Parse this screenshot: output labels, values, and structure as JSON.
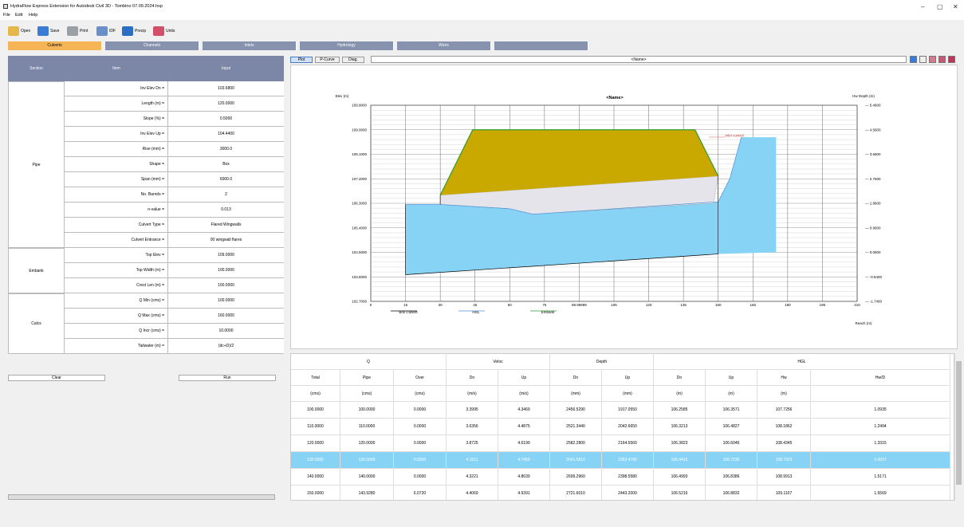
{
  "window": {
    "title": "HydraFlow Express Extension for Autodesk Civil 3D - Tombino 07.09.2024.hxp",
    "controls": [
      "–",
      "▢",
      "✕"
    ]
  },
  "menu": [
    "File",
    "Edit",
    "Help"
  ],
  "toolbar": {
    "open": "Open",
    "save": "Save",
    "print": "Print",
    "idf": "IDF",
    "precip": "Precip",
    "units": "Units"
  },
  "tabs": [
    "Culverts",
    "Channels",
    "Inlets",
    "Hydrology",
    "Weirs"
  ],
  "left_grid": {
    "headers": [
      "Section",
      "Item",
      "Input"
    ],
    "sections": [
      {
        "name": "Pipe",
        "rows": [
          [
            "Inv Elev Dn =",
            "103.6800"
          ],
          [
            "Length (m) =",
            "120.0000"
          ],
          [
            "Slope (%) =",
            "0.5000"
          ],
          [
            "Inv Elev Up =",
            "104.4400"
          ],
          [
            "Rise (mm) =",
            "3000.0"
          ],
          [
            "Shape =",
            "Box"
          ],
          [
            "Span (mm) =",
            "6000.0"
          ],
          [
            "No. Barrels =",
            "2"
          ],
          [
            "n-value =",
            "0.013"
          ],
          [
            "Culvert Type =",
            "Flared Wingwalls"
          ],
          [
            "Culvert Entrance =",
            "00 wingwall flares"
          ]
        ]
      },
      {
        "name": "Embank",
        "rows": [
          [
            "Top Elev =",
            "109.0000"
          ],
          [
            "Top Width (m) =",
            "100.0000"
          ],
          [
            "Crest Len (m) =",
            "100.0000"
          ]
        ]
      },
      {
        "name": "Calcs",
        "rows": [
          [
            "Q Min (cms) =",
            "100.0000"
          ],
          [
            "Q Max (cms) =",
            "160.0000"
          ],
          [
            "Q Incr (cms) =",
            "10.0000"
          ],
          [
            "Tailwater (m) =",
            "(dc+D)/2"
          ]
        ]
      }
    ],
    "clear_label": "Clear",
    "run_label": "Run"
  },
  "plot_toolbar": {
    "buttons": [
      "Plot",
      "P-Curve",
      "Diag."
    ],
    "name_value": "<Name>"
  },
  "chart_data": {
    "type": "line",
    "title": "<Name>",
    "ylabel_left": "Elev (m)",
    "ylabel_right": "Hw Depth (m)",
    "xlabel": "Reach (m)",
    "x_ticks": [
      "0",
      "15",
      "30",
      "45",
      "60",
      "75",
      "89.99999",
      "105",
      "120",
      "135",
      "150",
      "165",
      "180",
      "195",
      "210"
    ],
    "y_ticks_left": [
      "109.9000",
      "109.0000",
      "108.1000",
      "107.2000",
      "106.3000",
      "105.4000",
      "104.5000",
      "103.6000",
      "102.7000"
    ],
    "y_ticks_right": [
      "5.4600",
      "4.5600",
      "3.6600",
      "2.7600",
      "1.8600",
      "0.9600",
      "0.0600",
      "-0.8400",
      "-1.7400"
    ],
    "xlim": [
      0,
      210
    ],
    "ylim": [
      102.7,
      109.9
    ],
    "annotation": "Inlet control",
    "series": [
      {
        "name": "Box Culvert",
        "color": "#000000",
        "x": [
          15,
          150
        ],
        "y": [
          103.68,
          104.44
        ]
      },
      {
        "name": "HGL",
        "color": "#4a90d9",
        "x": [
          15,
          30,
          60,
          70,
          150,
          155,
          160
        ],
        "y": [
          106.2585,
          106.2585,
          106.1,
          105.9,
          106.3571,
          107.2,
          108.7256
        ]
      },
      {
        "name": "Embank",
        "color": "#2e9c2e",
        "x": [
          30,
          44,
          140,
          150
        ],
        "y": [
          106.6,
          109.0,
          109.0,
          107.3
        ]
      }
    ],
    "legend": [
      "Box Culvert",
      "HGL",
      "Embank"
    ],
    "legend_position": "bottom"
  },
  "results": {
    "group_headers": [
      "Q",
      "Veloc",
      "Depth",
      "HGL"
    ],
    "col_headers": [
      "Total",
      "Pipe",
      "Over",
      "Dn",
      "Up",
      "Dn",
      "Up",
      "Dn",
      "Up",
      "Hw",
      "Hw/D"
    ],
    "units": [
      "(cms)",
      "(cms)",
      "(cms)",
      "(m/s)",
      "(m/s)",
      "(mm)",
      "(mm)",
      "(m)",
      "(m)",
      "(m)",
      ""
    ],
    "rows": [
      [
        "100.0000",
        "100.0000",
        "0.0000",
        "3.3995",
        "4.3469",
        "2456.5290",
        "1917.0550",
        "106.2585",
        "106.3571",
        "107.7256",
        "1.0935"
      ],
      [
        "110.0000",
        "110.0000",
        "0.0000",
        "3.6356",
        "4.4875",
        "2521.3440",
        "2042.6650",
        "106.3213",
        "106.4827",
        "108.1862",
        "1.2494"
      ],
      [
        "120.0000",
        "120.0000",
        "0.0000",
        "3.8725",
        "4.6199",
        "2582.2800",
        "2164.5560",
        "106.3823",
        "106.6046",
        "108.4345",
        "1.3315"
      ],
      [
        "130.0000",
        "130.0000",
        "0.0000",
        "4.1011",
        "4.7459",
        "2641.5810",
        "2283.4790",
        "106.4415",
        "106.7235",
        "108.7023",
        "1.4207"
      ],
      [
        "140.0000",
        "140.0000",
        "0.0000",
        "4.3221",
        "4.8639",
        "2699.2960",
        "2398.5580",
        "106.4993",
        "106.8386",
        "108.9913",
        "1.5171"
      ],
      [
        "150.0000",
        "143.9280",
        "6.0720",
        "4.4069",
        "4.9391",
        "2721.6010",
        "2443.2000",
        "106.5216",
        "106.8832",
        "109.1107",
        "1.5569"
      ]
    ],
    "selected_row": 3
  },
  "colors": {
    "tab_active": "#f5b556",
    "tab_inactive": "#8792ae",
    "embankment": "#c9a800",
    "water": "#87d3f5",
    "selection": "#87d3f5"
  }
}
